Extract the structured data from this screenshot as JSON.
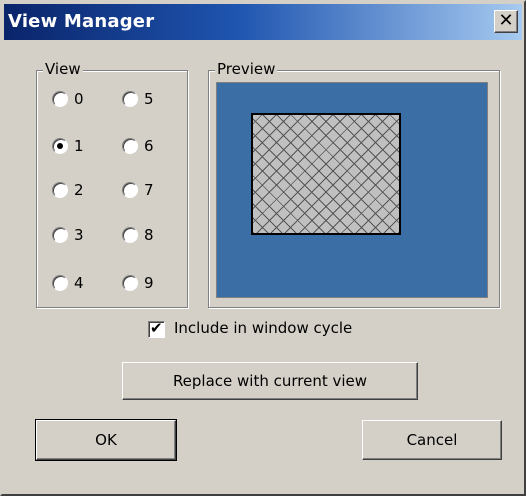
{
  "window": {
    "title": "View Manager",
    "close_glyph": "✕"
  },
  "view_group": {
    "label": "View",
    "options": [
      "0",
      "1",
      "2",
      "3",
      "4",
      "5",
      "6",
      "7",
      "8",
      "9"
    ],
    "selected": "1"
  },
  "preview_group": {
    "label": "Preview",
    "background_color": "#3a6ea5"
  },
  "include_cycle": {
    "label": "Include in window cycle",
    "checked": true
  },
  "buttons": {
    "replace": "Replace with current view",
    "ok": "OK",
    "cancel": "Cancel"
  },
  "colors": {
    "title_start": "#0a246a",
    "title_end": "#a6caf0",
    "face": "#d4d0c8"
  }
}
